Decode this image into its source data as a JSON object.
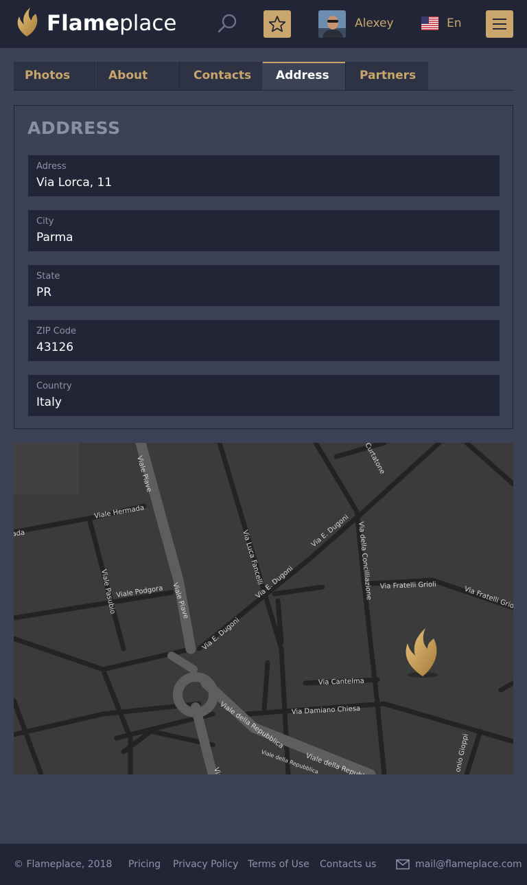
{
  "header": {
    "brand_bold": "Flame",
    "brand_light": "place",
    "username": "Alexey",
    "language": "En"
  },
  "tabs": [
    {
      "label": "Photos",
      "active": false
    },
    {
      "label": "About",
      "active": false
    },
    {
      "label": "Contacts",
      "active": false
    },
    {
      "label": "Address",
      "active": true
    },
    {
      "label": "Partners",
      "active": false
    }
  ],
  "address": {
    "title": "ADDRESS",
    "fields": [
      {
        "label": "Adress",
        "value": "Via Lorca, 11"
      },
      {
        "label": "City",
        "value": "Parma"
      },
      {
        "label": "State",
        "value": "PR"
      },
      {
        "label": "ZIP Code",
        "value": "43126"
      },
      {
        "label": "Country",
        "value": "Italy"
      }
    ]
  },
  "map": {
    "streets": [
      "Viale Piave",
      "Viale Hermada",
      "Viale Pasubio",
      "Viale Podgora",
      "Via Luca Fancelli",
      "Via E. Dugoni",
      "Via della Concilliazione",
      "Via Fratelli Grioli",
      "Via Cantelma",
      "Via Damiano Chiesa",
      "Viale della Repubblica",
      "Curtatone",
      "onio Gioppi"
    ]
  },
  "footer": {
    "copyright": "© Flameplace, 2018",
    "links": [
      "Pricing",
      "Privacy Policy",
      "Terms of Use",
      "Contacts us"
    ],
    "email": "mail@flameplace.com"
  },
  "colors": {
    "accent": "#c9a66b",
    "header_bg": "#222535",
    "page_bg": "#3b4256"
  }
}
